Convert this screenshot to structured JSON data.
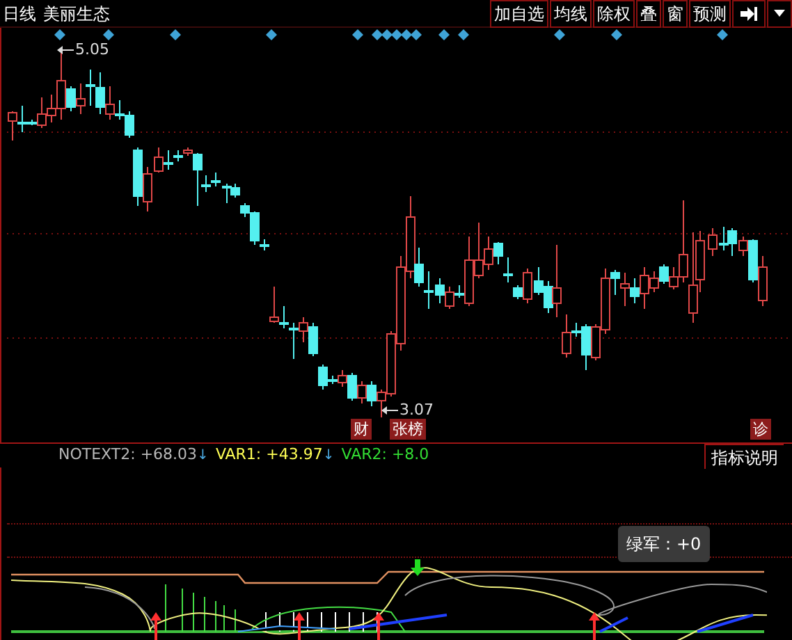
{
  "toolbar": {
    "period": "日线",
    "stock_name": "美丽生态",
    "buttons": [
      "加自选",
      "均线",
      "除权",
      "叠",
      "窗",
      "预测"
    ]
  },
  "price_chart": {
    "high_label": "5.05",
    "low_label": "3.07",
    "markers": [
      {
        "text": "财"
      },
      {
        "text": "张榜"
      },
      {
        "text": "诊"
      }
    ]
  },
  "indicator_bar": {
    "items": [
      {
        "label": "NOTEXT2:",
        "value": "+68.03",
        "color": "#b8b8b8",
        "arrow": "↓"
      },
      {
        "label": "VAR1:",
        "value": "+43.97",
        "color": "#ffff55",
        "arrow": "↓"
      },
      {
        "label": "VAR2:",
        "value": "+8.0",
        "color": "#33dd33"
      }
    ],
    "help_button": "指标说明"
  },
  "tooltip": {
    "text": "绿军：+0"
  }
}
